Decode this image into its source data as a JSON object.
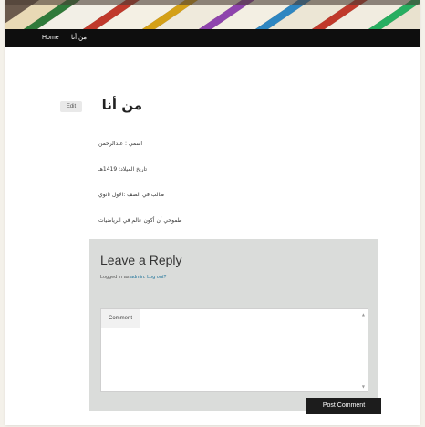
{
  "nav": {
    "items": [
      {
        "label": "Home"
      },
      {
        "label": "من أنا"
      }
    ]
  },
  "article": {
    "edit_label": "Edit",
    "title": "من أنا",
    "lines": [
      "اسمي : عبدالرحمن",
      "تاريخ الميلاد: 1419هـ",
      "طالب في الصف :الأول ثانوي",
      "طموحي أن أكون عالم في الرياضيات"
    ]
  },
  "comments": {
    "heading": "Leave a Reply",
    "logged_in_prefix": "Logged in as ",
    "user": "admin",
    "separator": ". ",
    "logout_label": "Log out?",
    "field_label": "Comment",
    "submit_label": "Post Comment"
  },
  "colors": {
    "navbar": "#0e0e0e",
    "reply_box": "#dadcda",
    "link": "#21759b",
    "button": "#1c1c1c"
  },
  "icons": {
    "scroll_up": "triangle-up",
    "scroll_down": "triangle-down"
  }
}
